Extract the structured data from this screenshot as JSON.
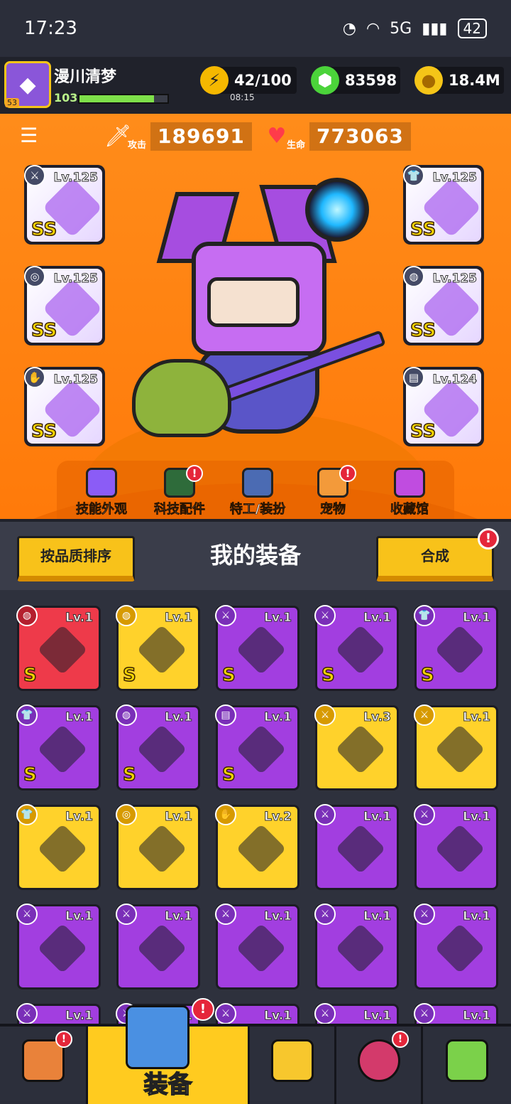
{
  "status_bar": {
    "time": "17:23",
    "signal": "5G",
    "battery": "42"
  },
  "player": {
    "name": "漫川清梦",
    "avatar_level": "53",
    "level": "103",
    "exp_fraction": 0.85
  },
  "resources": {
    "energy": {
      "value": "42/100",
      "timer": "08:15",
      "icon": "lightning-icon"
    },
    "gems": {
      "value": "83598",
      "icon": "green-gem-icon"
    },
    "coins": {
      "value": "18.4M",
      "icon": "gold-coin-icon"
    }
  },
  "stats": {
    "attack": {
      "label": "攻击",
      "value": "189691",
      "icon": "sword-icon"
    },
    "hp": {
      "label": "生命",
      "value": "773063",
      "icon": "heart-icon"
    }
  },
  "equipped": {
    "left": [
      {
        "level": "Lv.125",
        "rank": "SS",
        "type": "weapon"
      },
      {
        "level": "Lv.125",
        "rank": "SS",
        "type": "necklace"
      },
      {
        "level": "Lv.125",
        "rank": "SS",
        "type": "glove"
      }
    ],
    "right": [
      {
        "level": "Lv.125",
        "rank": "SS",
        "type": "armor"
      },
      {
        "level": "Lv.125",
        "rank": "SS",
        "type": "belt"
      },
      {
        "level": "Lv.124",
        "rank": "SS",
        "type": "boots"
      }
    ]
  },
  "sub_menu": [
    {
      "label": "技能外观",
      "badge": ""
    },
    {
      "label": "科技配件",
      "badge": "!"
    },
    {
      "label": "特工/装扮",
      "badge": ""
    },
    {
      "label": "宠物",
      "badge": "!"
    },
    {
      "label": "收藏馆",
      "badge": ""
    }
  ],
  "equipment_panel": {
    "sort_label": "按品质排序",
    "title": "我的装备",
    "merge_label": "合成",
    "merge_badge": "!"
  },
  "inventory": [
    {
      "level": "Lv.1",
      "rank": "S",
      "quality": "red",
      "type": "belt"
    },
    {
      "level": "Lv.1",
      "rank": "S",
      "quality": "yellow",
      "type": "belt"
    },
    {
      "level": "Lv.1",
      "rank": "S",
      "quality": "purple",
      "type": "weapon"
    },
    {
      "level": "Lv.1",
      "rank": "S",
      "quality": "purple",
      "type": "weapon"
    },
    {
      "level": "Lv.1",
      "rank": "S",
      "quality": "purple",
      "type": "armor"
    },
    {
      "level": "Lv.1",
      "rank": "S",
      "quality": "purple",
      "type": "armor"
    },
    {
      "level": "Lv.1",
      "rank": "S",
      "quality": "purple",
      "type": "belt"
    },
    {
      "level": "Lv.1",
      "rank": "S",
      "quality": "purple",
      "type": "boots"
    },
    {
      "level": "Lv.3",
      "rank": "",
      "quality": "yellow",
      "type": "weapon"
    },
    {
      "level": "Lv.1",
      "rank": "",
      "quality": "yellow",
      "type": "weapon"
    },
    {
      "level": "Lv.1",
      "rank": "",
      "quality": "yellow",
      "type": "armor"
    },
    {
      "level": "Lv.1",
      "rank": "",
      "quality": "yellow",
      "type": "necklace"
    },
    {
      "level": "Lv.2",
      "rank": "",
      "quality": "yellow",
      "type": "glove"
    },
    {
      "level": "Lv.1",
      "rank": "",
      "quality": "purple",
      "type": "weapon"
    },
    {
      "level": "Lv.1",
      "rank": "",
      "quality": "purple",
      "type": "weapon"
    },
    {
      "level": "Lv.1",
      "rank": "",
      "quality": "purple",
      "type": "weapon"
    },
    {
      "level": "Lv.1",
      "rank": "",
      "quality": "purple",
      "type": "weapon"
    },
    {
      "level": "Lv.1",
      "rank": "",
      "quality": "purple",
      "type": "weapon"
    },
    {
      "level": "Lv.1",
      "rank": "",
      "quality": "purple",
      "type": "weapon"
    },
    {
      "level": "Lv.1",
      "rank": "",
      "quality": "purple",
      "type": "weapon"
    },
    {
      "level": "Lv.1",
      "rank": "",
      "quality": "purple",
      "type": "weapon"
    },
    {
      "level": "Lv.1",
      "rank": "",
      "quality": "purple",
      "type": "weapon"
    },
    {
      "level": "Lv.1",
      "rank": "",
      "quality": "purple",
      "type": "weapon"
    },
    {
      "level": "Lv.1",
      "rank": "",
      "quality": "purple",
      "type": "weapon"
    },
    {
      "level": "Lv.1",
      "rank": "",
      "quality": "purple",
      "type": "weapon"
    }
  ],
  "tabs": [
    {
      "name": "shop",
      "label": "",
      "badge": "!",
      "icon": "shop-icon"
    },
    {
      "name": "equipment",
      "label": "装备",
      "badge": "!",
      "icon": "equipment-icon"
    },
    {
      "name": "battle",
      "label": "",
      "badge": "",
      "icon": "crossed-swords-star-icon"
    },
    {
      "name": "talent",
      "label": "",
      "badge": "!",
      "icon": "stars-orb-icon"
    },
    {
      "name": "evolve",
      "label": "",
      "badge": "",
      "icon": "dna-capsule-icon"
    }
  ],
  "colors": {
    "arena_orange": "#ff8c1a",
    "quality_red": "#ee3a4a",
    "quality_yellow": "#ffd22b",
    "quality_purple": "#a23ee0",
    "badge_red": "#e5263a"
  }
}
